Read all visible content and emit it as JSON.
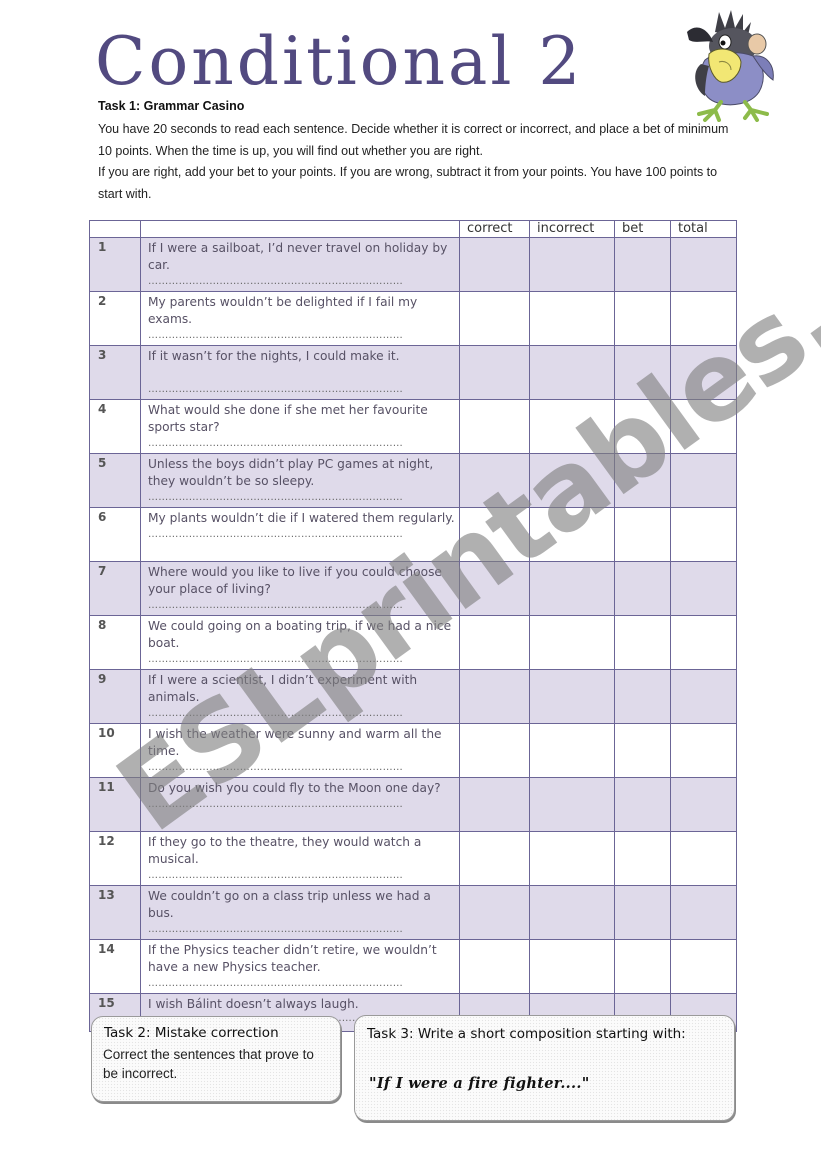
{
  "title": "Conditional 2",
  "mascot": {
    "icon": "cartoon-crow-mascot-icon",
    "colors": {
      "body": "#8c8ec6",
      "beak": "#f2e774",
      "feet": "#8dbb4a",
      "head": "#3f3f46"
    }
  },
  "task1": {
    "heading": "Task 1: Grammar Casino",
    "paragraphs": [
      "You have 20 seconds to read each sentence. Decide whether it is correct or incorrect, and place a bet of minimum 10 points.  When the time is up, you will find out whether you are right.",
      "If you are right, add your bet to your points. If you are wrong, subtract it from your points. You have 100 points to start with."
    ]
  },
  "table": {
    "columns": [
      "",
      "",
      "correct",
      "incorrect",
      "bet",
      "total"
    ],
    "rows": [
      {
        "num": "1",
        "sentence": "If I were a sailboat, I’d never travel on holiday by car."
      },
      {
        "num": "2",
        "sentence": "My parents wouldn’t be delighted if I fail my exams."
      },
      {
        "num": "3",
        "sentence": "If it wasn’t for the nights, I could make it."
      },
      {
        "num": "4",
        "sentence": "What would she done if she met her favourite sports star?"
      },
      {
        "num": "5",
        "sentence": "Unless the boys didn’t play PC games at night, they wouldn’t be so sleepy."
      },
      {
        "num": "6",
        "sentence": "My plants wouldn’t die if I watered them regularly."
      },
      {
        "num": "7",
        "sentence": "Where would you like to live if you could choose your place of living?"
      },
      {
        "num": "8",
        "sentence": "We could going on a boating trip, if we had a nice boat."
      },
      {
        "num": "9",
        "sentence": "If I were a scientist, I didn’t experiment with animals."
      },
      {
        "num": "10",
        "sentence": "I wish the weather were sunny and warm all the time."
      },
      {
        "num": "11",
        "sentence": "Do you wish you could fly to the Moon one day?"
      },
      {
        "num": "12",
        "sentence": "If they go to the theatre, they would watch a musical."
      },
      {
        "num": "13",
        "sentence": "We couldn’t go on a class trip unless we had a bus."
      },
      {
        "num": "14",
        "sentence": "If the Physics teacher didn’t retire, we wouldn’t have a new Physics teacher."
      },
      {
        "num": "15",
        "sentence": "I wish Bálint doesn’t always laugh."
      }
    ],
    "answer_line": "…………………………………………………………………",
    "colors": {
      "shaded_row": "#dfdaea",
      "border": "#6b6596"
    }
  },
  "task2": {
    "title": "Task 2: Mistake correction",
    "text": "Correct the sentences that prove to be incorrect."
  },
  "task3": {
    "title": "Task 3: Write a short composition starting with:",
    "quote": "\"If I were a fire fighter....\""
  },
  "watermark": "ESLprintables.com",
  "colors": {
    "title": "#524a80"
  }
}
